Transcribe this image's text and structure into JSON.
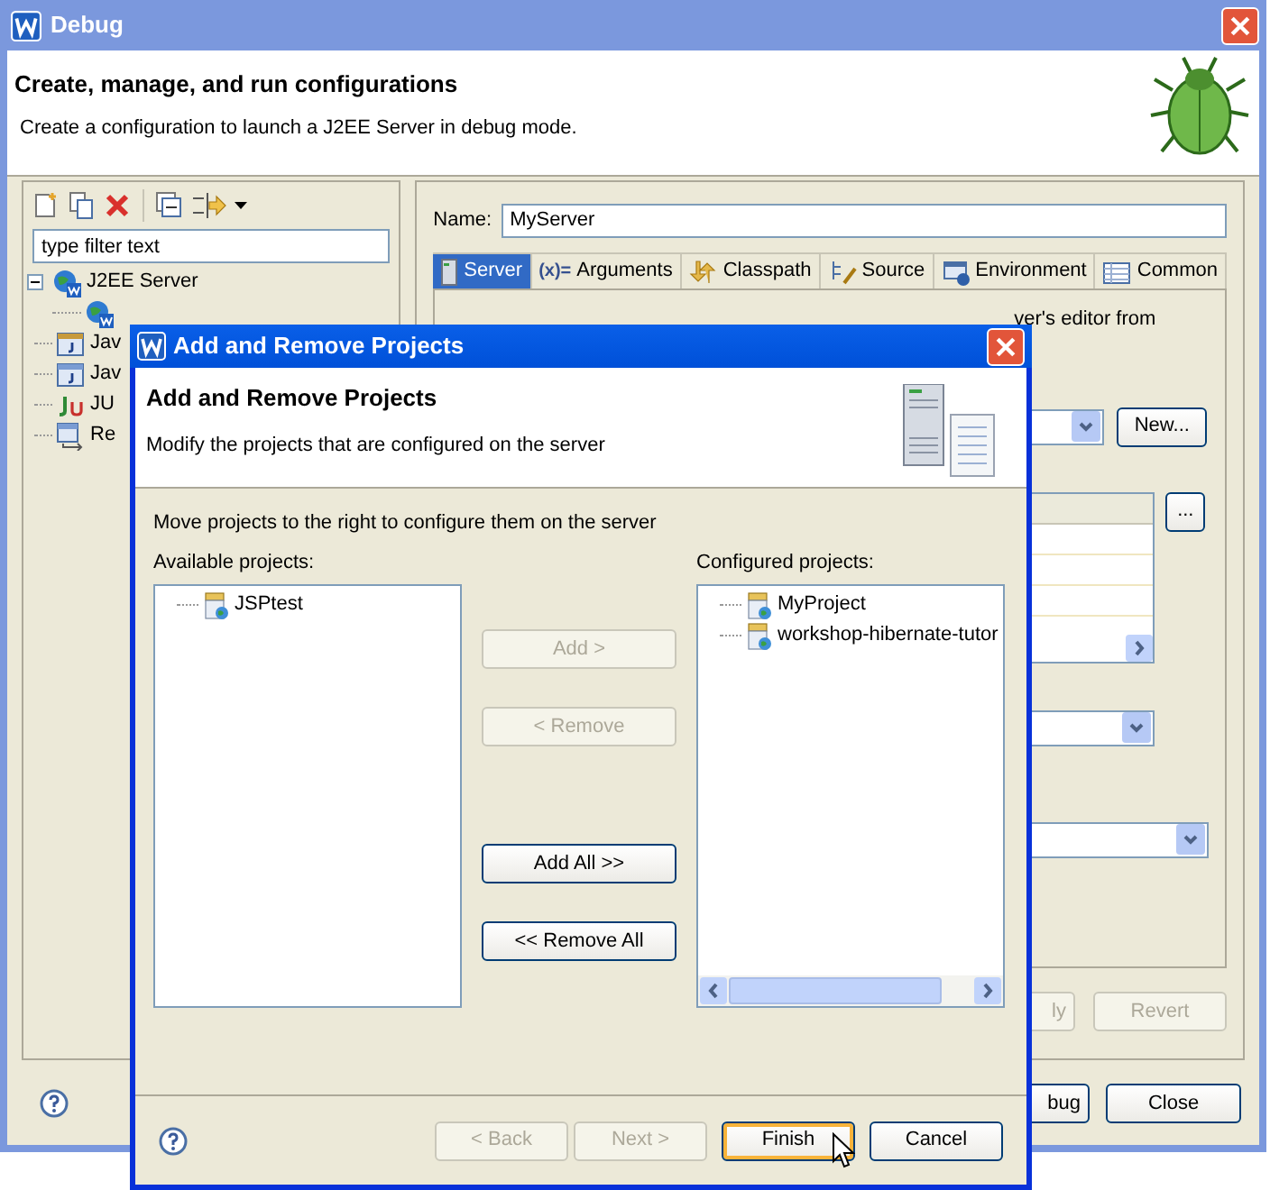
{
  "window": {
    "title": "Debug"
  },
  "header": {
    "title": "Create, manage, and run configurations",
    "description": "Create a configuration to launch a J2EE Server in debug mode."
  },
  "filter": {
    "placeholder": "type filter text"
  },
  "tree": [
    {
      "label": "J2EE Server",
      "kind": "server",
      "expanded": true,
      "children": [
        {
          "kind": "server"
        }
      ]
    },
    {
      "label": "Jav",
      "kind": "applet"
    },
    {
      "label": "Jav",
      "kind": "java"
    },
    {
      "label": "JU",
      "kind": "junit"
    },
    {
      "label": "Re",
      "kind": "remote"
    }
  ],
  "editor": {
    "name_label": "Name:",
    "name_value": "MyServer",
    "tabs": [
      {
        "label": "Server",
        "kind": "server",
        "selected": true
      },
      {
        "label": "Arguments",
        "kind": "arguments",
        "icon_text": "(x)=",
        "selected": false
      },
      {
        "label": "Classpath",
        "kind": "classpath",
        "selected": false
      },
      {
        "label": "Source",
        "kind": "source",
        "selected": false
      },
      {
        "label": "Environment",
        "kind": "environment",
        "selected": false
      },
      {
        "label": "Common",
        "kind": "common",
        "selected": false
      }
    ],
    "description_fragment": "ver's editor from",
    "new_button": "New...",
    "browse_button": "..."
  },
  "action_buttons": [
    {
      "label": "ly",
      "disabled": true
    },
    {
      "label": "Revert",
      "disabled": true
    }
  ],
  "footer_buttons": [
    {
      "label": "bug",
      "disabled": false
    },
    {
      "label": "Close",
      "disabled": false
    }
  ],
  "dialog": {
    "title": "Add and Remove Projects",
    "header": {
      "title": "Add and Remove Projects",
      "description": "Modify the projects that are configured on the server"
    },
    "instruction": "Move projects to the right to configure them on the server",
    "available": {
      "label": "Available projects:",
      "items": [
        "JSPtest"
      ]
    },
    "move_buttons": [
      {
        "label": "Add >",
        "disabled": true
      },
      {
        "label": "< Remove",
        "disabled": true
      },
      {
        "label": "Add All >>",
        "disabled": false
      },
      {
        "label": "<< Remove All",
        "disabled": false
      }
    ],
    "configured": {
      "label": "Configured projects:",
      "items": [
        "MyProject",
        "workshop-hibernate-tutor"
      ]
    },
    "footer_buttons": [
      {
        "label": "< Back",
        "disabled": true,
        "default": false
      },
      {
        "label": "Next >",
        "disabled": true,
        "default": false
      },
      {
        "label": "Finish",
        "disabled": false,
        "default": true
      },
      {
        "label": "Cancel",
        "disabled": false,
        "default": false
      }
    ]
  }
}
